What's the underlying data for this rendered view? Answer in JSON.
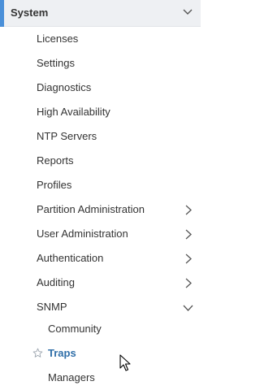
{
  "nav": {
    "section_title": "System",
    "items": [
      {
        "label": "Licenses"
      },
      {
        "label": "Settings"
      },
      {
        "label": "Diagnostics"
      },
      {
        "label": "High Availability"
      },
      {
        "label": "NTP Servers"
      },
      {
        "label": "Reports"
      },
      {
        "label": "Profiles"
      },
      {
        "label": "Partition Administration"
      },
      {
        "label": "User Administration"
      },
      {
        "label": "Authentication"
      },
      {
        "label": "Auditing"
      },
      {
        "label": "SNMP"
      }
    ],
    "snmp_children": [
      {
        "label": "Community"
      },
      {
        "label": "Traps"
      },
      {
        "label": "Managers"
      }
    ]
  },
  "colors": {
    "accent": "#4a90d9",
    "active_text": "#2f6ea8",
    "header_bg": "#eef0f3"
  }
}
